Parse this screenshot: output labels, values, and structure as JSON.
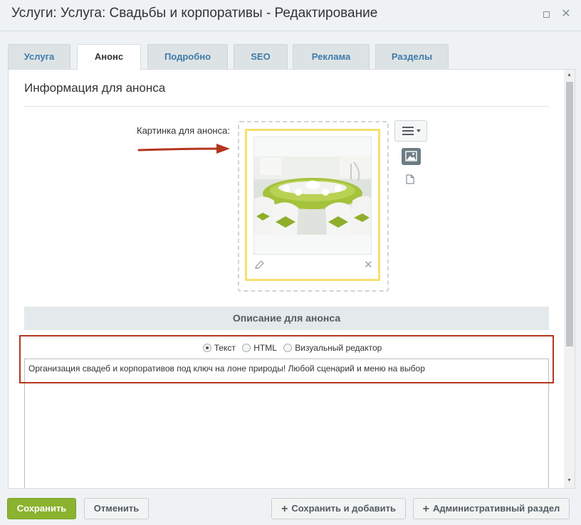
{
  "window": {
    "title": "Услуги: Услуга: Свадьбы и корпоративы - Редактирование"
  },
  "tabs": [
    {
      "label": "Услуга",
      "active": false
    },
    {
      "label": "Анонс",
      "active": true
    },
    {
      "label": "Подробно",
      "active": false
    },
    {
      "label": "SEO",
      "active": false
    },
    {
      "label": "Реклама",
      "active": false
    },
    {
      "label": "Разделы",
      "active": false
    }
  ],
  "section": {
    "heading": "Информация для анонса",
    "image_label": "Картинка для анонса:",
    "description_heading": "Описание для анонса"
  },
  "editor": {
    "modes": [
      {
        "label": "Текст",
        "checked": true
      },
      {
        "label": "HTML",
        "checked": false
      },
      {
        "label": "Визуальный редактор",
        "checked": false
      }
    ],
    "text": "Организация свадеб и корпоративов под ключ на лоне природы! Любой сценарий и меню на выбор"
  },
  "footer": {
    "save": "Сохранить",
    "cancel": "Отменить",
    "save_add": "Сохранить и добавить",
    "admin_section": "Административный раздел"
  },
  "colors": {
    "accent_green": "#8bb32f",
    "tab_text": "#3f7aa9",
    "highlight_red": "#b5361d",
    "image_frame_yellow": "#f5e06e"
  },
  "icons": [
    "maximize-icon",
    "close-icon",
    "menu-icon",
    "image-icon",
    "file-icon",
    "pencil-icon",
    "delete-icon",
    "plus-icon",
    "arrow-annotation"
  ]
}
